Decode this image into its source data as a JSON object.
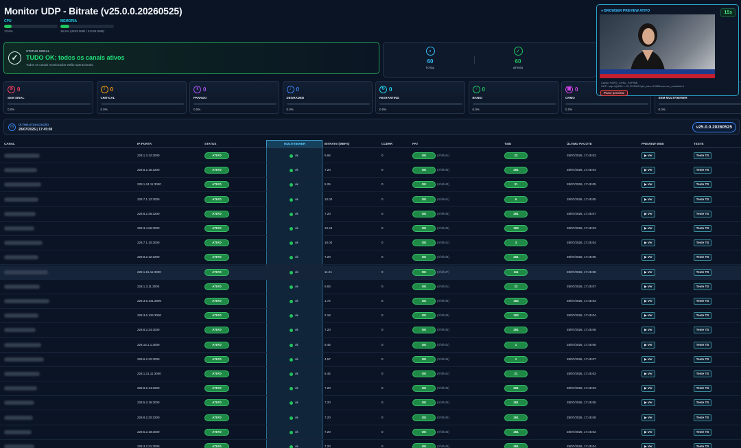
{
  "app": {
    "title": "Monitor UDP - Bitrate (v25.0.0.20260525)",
    "cpu": {
      "label": "CPU",
      "value": "13.6%",
      "percent": 13.6
    },
    "memory": {
      "label": "MEMORIA",
      "value": "16.6% (4293.2MB / 24136.0MB)",
      "percent": 16.6
    }
  },
  "status": {
    "label": "STATUS GERAL",
    "main": "TUDO OK: todos os canais ativos",
    "sub": "Todos os canais monitorados estão operacionais."
  },
  "totals": [
    {
      "value": "60",
      "label": "TOTAL",
      "color": "#38bdf8",
      "icon": "broadcast-icon"
    },
    {
      "value": "60",
      "label": "ATIVOS",
      "color": "#22c55e",
      "icon": "check-circle-icon"
    }
  ],
  "preview": {
    "title": "BROWSER PREVIEW ATIVO",
    "timer": "15s",
    "info1": "Canal: HDR2_CHNL_SVPINE",
    "info2": "UDP: udp://@239.1.15.13:3000?pkt_size=1316&overrun_nonfatal=1",
    "stop_label": "Parar preview"
  },
  "categories": [
    {
      "count": "0",
      "name": "SEM SINAL",
      "pct": "0.0%",
      "color": "#f43f5e",
      "icon": "no-signal-icon"
    },
    {
      "count": "0",
      "name": "CRITICAL",
      "pct": "0.0%",
      "color": "#f59e0b",
      "icon": "warning-icon"
    },
    {
      "count": "0",
      "name": "PARADO",
      "pct": "0.0%",
      "color": "#a855f7",
      "icon": "pause-icon"
    },
    {
      "count": "0",
      "name": "DEGRADED",
      "pct": "0.0%",
      "color": "#3b82f6",
      "icon": "degraded-icon"
    },
    {
      "count": "0",
      "name": "RESTARTING",
      "pct": "0.0%",
      "color": "#22d3ee",
      "icon": "restart-icon"
    },
    {
      "count": "0",
      "name": "BANIO",
      "pct": "0.0%",
      "color": "#22c55e",
      "icon": "arrow-up-icon"
    },
    {
      "count": "0",
      "name": "CRMO",
      "pct": "0.0%",
      "color": "#d946ef",
      "icon": "grid-icon"
    },
    {
      "count": "0",
      "name": "SEM MULTIVIEWER",
      "pct": "0.0%",
      "color": "#94a3b8",
      "icon": "monitor-icon"
    }
  ],
  "update": {
    "label": "ÚLTIMA ATUALIZAÇÃO",
    "value": "28/07/2026 | 17:45:08",
    "version": "v25.0.0.20260525"
  },
  "table": {
    "headers": {
      "canal": "CANAL",
      "ip_porta": "IP:PORTA",
      "status": "STATUS",
      "multiviewer": "MULTIVIEWER",
      "bitrate": "BITRATE (MBPS)",
      "ccerr": "CCERR",
      "pat": "PAT",
      "tsid": "TSID",
      "ultimo_pacote": "ÚLTIMO PACOTE",
      "preview": "PREVIEW WEB",
      "teste": "TESTE"
    },
    "status_label": "ATIVO",
    "mv_label": "ok",
    "pat_label": "OK",
    "preview_label": "▶ Ver",
    "test_label": "Teste TS",
    "rows": [
      {
        "name_w": 52,
        "ip": "228.1.3.12:3000",
        "bitrate": "5.65",
        "ccerr": "0",
        "pat_info": "(r/hhlnl1)",
        "tsid": "22",
        "last": "28/07/2026, 17:45:03"
      },
      {
        "name_w": 48,
        "ip": "228.8.2.15:3200",
        "bitrate": "7.20",
        "ccerr": "0",
        "pat_info": "(r/hhlnl3)",
        "tsid": "261",
        "last": "28/07/2026, 17:45:04"
      },
      {
        "name_w": 54,
        "ip": "228.1.24.11:3000",
        "bitrate": "5.25",
        "ccerr": "0",
        "pat_info": "(r/hhlnl3)",
        "tsid": "31",
        "last": "28/07/2026, 17:45:05"
      },
      {
        "name_w": 50,
        "ip": "228.7.1.12:3000",
        "bitrate": "10.00",
        "ccerr": "0",
        "pat_info": "(r/hhlnl1)",
        "tsid": "5",
        "last": "28/07/2026, 17:45:05"
      },
      {
        "name_w": 46,
        "ip": "228.8.2.36:3200",
        "bitrate": "7.20",
        "ccerr": "0",
        "pat_info": "(r/hhlnl3)",
        "tsid": "261",
        "last": "28/07/2026, 17:45:07"
      },
      {
        "name_w": 44,
        "ip": "228.3.4.66:3000",
        "bitrate": "10.43",
        "ccerr": "0",
        "pat_info": "(r/hhlnl3)",
        "tsid": "163",
        "last": "28/07/2026, 17:45:03"
      },
      {
        "name_w": 56,
        "ip": "228.7.1.10:3000",
        "bitrate": "10.00",
        "ccerr": "0",
        "pat_info": "(r/hhlnl1)",
        "tsid": "3",
        "last": "28/07/2026, 17:45:04"
      },
      {
        "name_w": 50,
        "ip": "228.8.2.12:3200",
        "bitrate": "7.20",
        "ccerr": "0",
        "pat_info": "(r/hhlnl3)",
        "tsid": "261",
        "last": "28/07/2026, 17:45:05"
      },
      {
        "name_w": 64,
        "ip": "228.1.15.11:3000",
        "bitrate": "11.01",
        "ccerr": "0",
        "pat_info": "(r/hhlnl7)",
        "tsid": "111",
        "last": "28/07/2026, 17:45:08"
      },
      {
        "name_w": 52,
        "ip": "228.1.3.11:3000",
        "bitrate": "5.63",
        "ccerr": "0",
        "pat_info": "(r/hhlnl1)",
        "tsid": "22",
        "last": "28/07/2026, 17:45:07"
      },
      {
        "name_w": 66,
        "ip": "228.3.6.141:3000",
        "bitrate": "1.72",
        "ccerr": "0",
        "pat_info": "(r/hhlnl3)",
        "tsid": "163",
        "last": "28/07/2026, 17:45:03"
      },
      {
        "name_w": 50,
        "ip": "228.3.6.134:3000",
        "bitrate": "2.18",
        "ccerr": "0",
        "pat_info": "(r/hhlnl3)",
        "tsid": "163",
        "last": "28/07/2026, 17:45:04"
      },
      {
        "name_w": 46,
        "ip": "228.8.2.34:3000",
        "bitrate": "7.20",
        "ccerr": "0",
        "pat_info": "(r/hhlnl3)",
        "tsid": "261",
        "last": "28/07/2026, 17:45:08"
      },
      {
        "name_w": 54,
        "ip": "228.15.1.1:3000",
        "bitrate": "5.45",
        "ccerr": "0",
        "pat_info": "(r/hhlnl1)",
        "tsid": "1",
        "last": "28/07/2026, 17:45:08"
      },
      {
        "name_w": 58,
        "ip": "228.6.2.22:3000",
        "bitrate": "4.57",
        "ccerr": "0",
        "pat_info": "(r/hhlnl3)",
        "tsid": "1",
        "last": "28/07/2026, 17:45:07"
      },
      {
        "name_w": 52,
        "ip": "228.1.21.11:3000",
        "bitrate": "5.44",
        "ccerr": "0",
        "pat_info": "(r/hhlnl1)",
        "tsid": "21",
        "last": "28/07/2026, 17:45:03"
      },
      {
        "name_w": 48,
        "ip": "228.8.2.14:3200",
        "bitrate": "7.20",
        "ccerr": "0",
        "pat_info": "(r/hhlnl3)",
        "tsid": "261",
        "last": "28/07/2026, 17:45:03"
      },
      {
        "name_w": 44,
        "ip": "228.5.2.16:3000",
        "bitrate": "7.20",
        "ccerr": "0",
        "pat_info": "(r/hhlnl3)",
        "tsid": "261",
        "last": "28/07/2026, 17:45:05"
      },
      {
        "name_w": 42,
        "ip": "228.8.2.20:3200",
        "bitrate": "7.20",
        "ccerr": "0",
        "pat_info": "(r/hhlnl3)",
        "tsid": "261",
        "last": "28/07/2026, 17:45:08"
      },
      {
        "name_w": 40,
        "ip": "228.5.2.18:3000",
        "bitrate": "7.20",
        "ccerr": "0",
        "pat_info": "(r/hhlnl3)",
        "tsid": "261",
        "last": "28/07/2026, 17:45:03"
      },
      {
        "name_w": 44,
        "ip": "228.3.2.21:3000",
        "bitrate": "7.20",
        "ccerr": "0",
        "pat_info": "(r/hhlnl3)",
        "tsid": "261",
        "last": "28/07/2026, 17:45:04"
      }
    ]
  }
}
